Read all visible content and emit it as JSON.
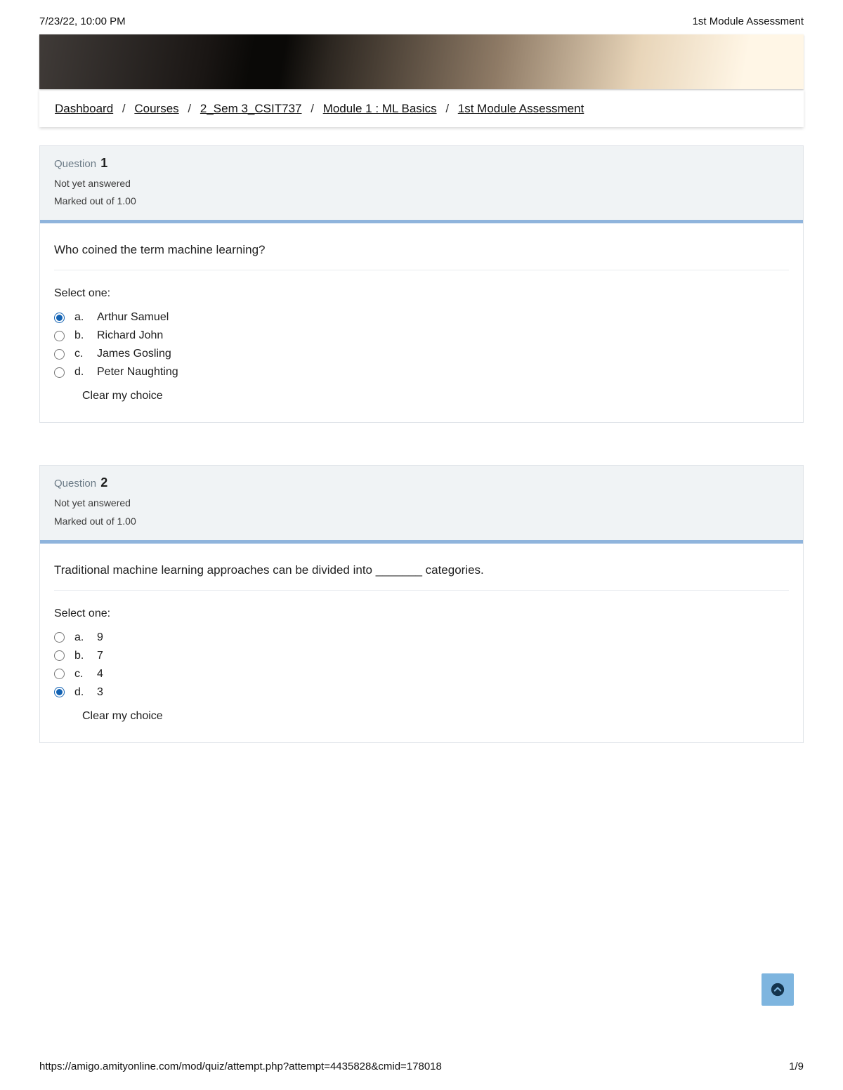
{
  "print": {
    "timestamp": "7/23/22, 10:00 PM",
    "title": "1st Module Assessment",
    "url": "https://amigo.amityonline.com/mod/quiz/attempt.php?attempt=4435828&cmid=178018",
    "page": "1/9"
  },
  "breadcrumb": [
    "Dashboard",
    "Courses",
    "2_Sem 3_CSIT737",
    "Module 1 : ML Basics",
    "1st Module Assessment"
  ],
  "labels": {
    "question_word": "Question",
    "select_one": "Select one:",
    "clear": "Clear my choice"
  },
  "questions": [
    {
      "number": "1",
      "status": "Not yet answered",
      "marks": "Marked out of 1.00",
      "stem": "Who coined the term machine learning?",
      "options": [
        {
          "letter": "a.",
          "text": "Arthur Samuel"
        },
        {
          "letter": "b.",
          "text": "Richard John"
        },
        {
          "letter": "c.",
          "text": "James Gosling"
        },
        {
          "letter": "d.",
          "text": "Peter Naughting"
        }
      ],
      "selected": 0
    },
    {
      "number": "2",
      "status": "Not yet answered",
      "marks": "Marked out of 1.00",
      "stem": "Traditional machine learning approaches can be divided into _______ categories.",
      "options": [
        {
          "letter": "a.",
          "text": "9"
        },
        {
          "letter": "b.",
          "text": "7"
        },
        {
          "letter": "c.",
          "text": "4"
        },
        {
          "letter": "d.",
          "text": "3"
        }
      ],
      "selected": 3
    }
  ]
}
